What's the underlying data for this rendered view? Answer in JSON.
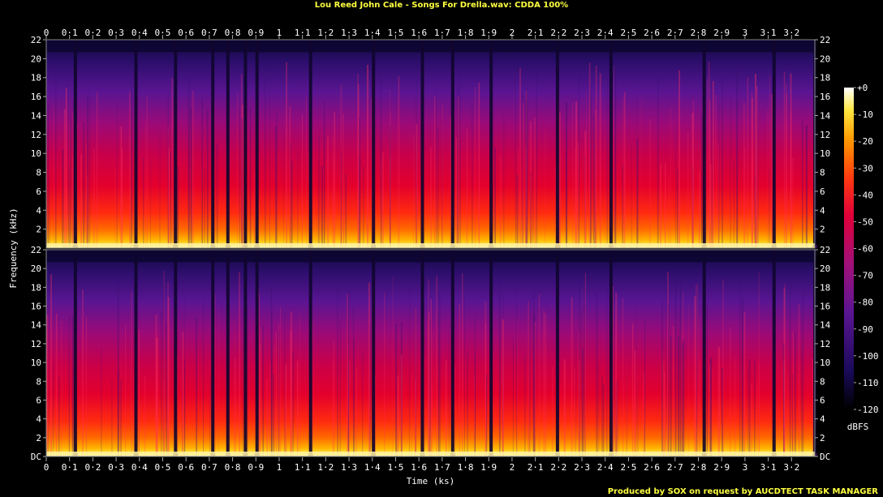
{
  "title": "Lou Reed John Cale - Songs For Drella.wav: CDDA 100%",
  "footer": "Produced by SOX on request by AUCDTECT TASK MANAGER",
  "chart_data": {
    "type": "heatmap",
    "title": "Lou Reed John Cale - Songs For Drella.wav: CDDA 100%",
    "xlabel": "Time (ks)",
    "ylabel": "Frequency (kHz)",
    "xlim": [
      0,
      3.3
    ],
    "ylim": [
      0,
      22
    ],
    "channels": 2,
    "x_ticks": [
      "0",
      "0·1",
      "0·2",
      "0·3",
      "0·4",
      "0·5",
      "0·6",
      "0·7",
      "0·8",
      "0·9",
      "1",
      "1·1",
      "1·2",
      "1·3",
      "1·4",
      "1·5",
      "1·6",
      "1·7",
      "1·8",
      "1·9",
      "2",
      "2·1",
      "2·2",
      "2·3",
      "2·4",
      "2·5",
      "2·6",
      "2·7",
      "2·8",
      "2·9",
      "3",
      "3·1",
      "3·2"
    ],
    "y_ticks_top": [
      "2",
      "4",
      "6",
      "8",
      "10",
      "12",
      "14",
      "16",
      "18",
      "20",
      "22"
    ],
    "y_ticks_bottom": [
      "DC",
      "2",
      "4",
      "6",
      "8",
      "10",
      "12",
      "14",
      "16",
      "18",
      "20",
      "22"
    ],
    "colorbar": {
      "label": "dBFS",
      "ticks": [
        "+0",
        "-10",
        "-20",
        "-30",
        "-40",
        "-50",
        "-60",
        "-70",
        "-80",
        "-90",
        "-100",
        "-110",
        "-120"
      ],
      "range": [
        -120,
        0
      ]
    },
    "track_boundaries_ks": [
      0.125,
      0.385,
      0.555,
      0.715,
      0.78,
      0.855,
      0.905,
      1.135,
      1.405,
      1.615,
      1.745,
      1.91,
      2.195,
      2.425,
      2.825,
      3.125,
      3.3
    ]
  }
}
